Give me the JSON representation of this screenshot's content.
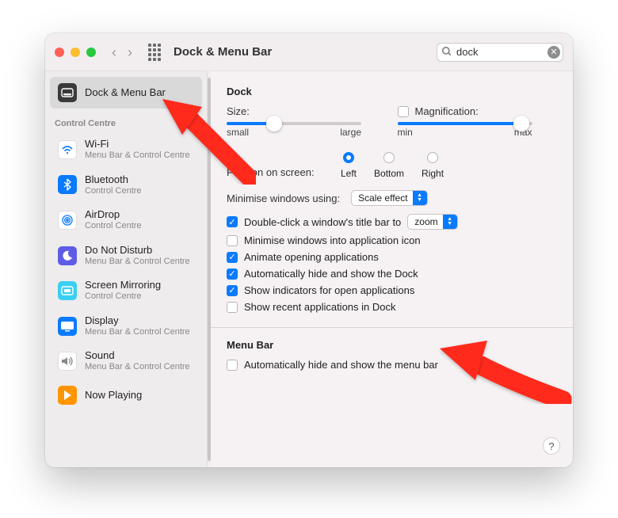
{
  "window": {
    "title": "Dock & Menu Bar"
  },
  "search": {
    "value": "dock"
  },
  "sidebar": {
    "header": "Control Centre",
    "items": [
      {
        "title": "Dock & Menu Bar",
        "subtitle": ""
      },
      {
        "title": "Wi-Fi",
        "subtitle": "Menu Bar & Control Centre"
      },
      {
        "title": "Bluetooth",
        "subtitle": "Control Centre"
      },
      {
        "title": "AirDrop",
        "subtitle": "Control Centre"
      },
      {
        "title": "Do Not Disturb",
        "subtitle": "Menu Bar & Control Centre"
      },
      {
        "title": "Screen Mirroring",
        "subtitle": "Control Centre"
      },
      {
        "title": "Display",
        "subtitle": "Menu Bar & Control Centre"
      },
      {
        "title": "Sound",
        "subtitle": "Menu Bar & Control Centre"
      },
      {
        "title": "Now Playing",
        "subtitle": ""
      }
    ]
  },
  "dock": {
    "section": "Dock",
    "sizeLabel": "Size:",
    "sizeSmall": "small",
    "sizeLarge": "large",
    "magLabel": "Magnification:",
    "magMin": "min",
    "magMax": "max",
    "positionLabel": "Position on screen:",
    "posLeft": "Left",
    "posBottom": "Bottom",
    "posRight": "Right",
    "minUsingLabel": "Minimise windows using:",
    "minEffect": "Scale effect",
    "dblClickPrefix": "Double-click a window's title bar to",
    "dblClickValue": "zoom",
    "optMinIntoApp": "Minimise windows into application icon",
    "optAnimate": "Animate opening applications",
    "optAutoHide": "Automatically hide and show the Dock",
    "optIndicators": "Show indicators for open applications",
    "optRecent": "Show recent applications in Dock"
  },
  "menubar": {
    "section": "Menu Bar",
    "autoHide": "Automatically hide and show the menu bar"
  }
}
